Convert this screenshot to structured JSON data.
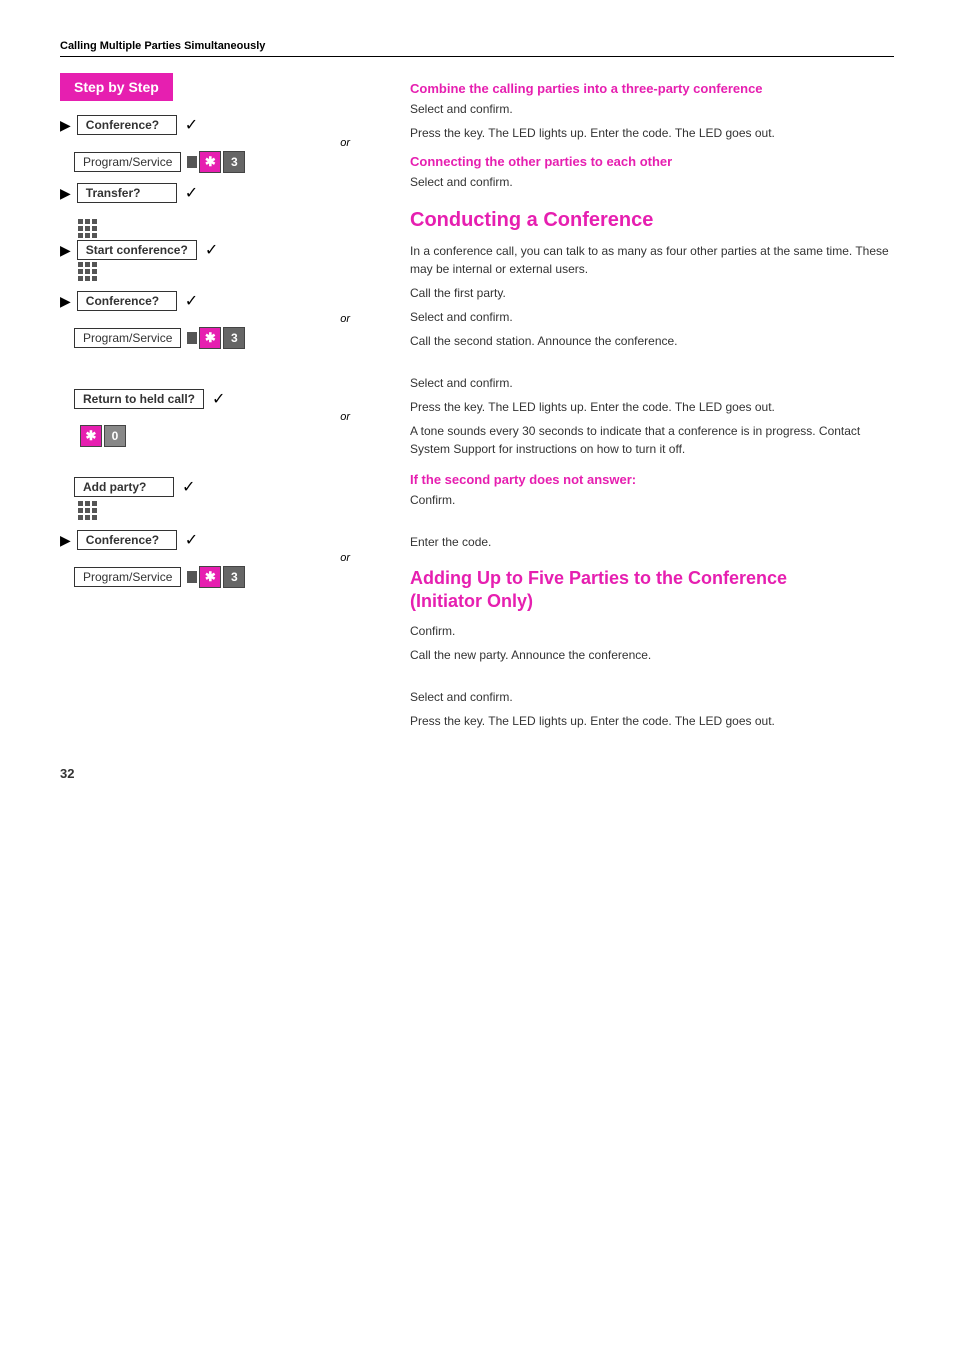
{
  "page": {
    "section_header": "Calling Multiple Parties Simultaneously",
    "step_by_step_label": "Step by Step",
    "page_number": "32"
  },
  "left": {
    "groups": [
      {
        "id": "group1",
        "rows": [
          {
            "type": "arrow-btn-check",
            "arrow": true,
            "label": "Conference?",
            "check": true
          },
          {
            "type": "or",
            "text": "or"
          },
          {
            "type": "prog-key",
            "prog_label": "Program/Service",
            "key_star": "*",
            "key_num": "3"
          }
        ]
      },
      {
        "id": "group2",
        "rows": [
          {
            "type": "arrow-btn-check",
            "arrow": true,
            "label": "Transfer?",
            "check": true
          }
        ]
      },
      {
        "id": "group3",
        "rows": [
          {
            "type": "dots-only"
          },
          {
            "type": "arrow-btn-check",
            "arrow": true,
            "label": "Start conference?",
            "check": true
          },
          {
            "type": "dots-only"
          }
        ]
      },
      {
        "id": "group4",
        "rows": [
          {
            "type": "arrow-btn-check",
            "arrow": true,
            "label": "Conference?",
            "check": true
          },
          {
            "type": "or",
            "text": "or"
          },
          {
            "type": "prog-key",
            "prog_label": "Program/Service",
            "key_star": "*",
            "key_num": "3"
          }
        ]
      },
      {
        "id": "group5",
        "rows": [
          {
            "type": "btn-check-noarrow",
            "label": "Return to held call?",
            "check": true
          },
          {
            "type": "or",
            "text": "or"
          },
          {
            "type": "star-zero",
            "key_star": "*",
            "key_num": "0"
          }
        ]
      },
      {
        "id": "group6",
        "rows": [
          {
            "type": "btn-check-noarrow",
            "label": "Add party?",
            "check": true
          },
          {
            "type": "dots-only"
          }
        ]
      },
      {
        "id": "group7",
        "rows": [
          {
            "type": "arrow-btn-check",
            "arrow": true,
            "label": "Conference?",
            "check": true
          },
          {
            "type": "or",
            "text": "or"
          },
          {
            "type": "prog-key",
            "prog_label": "Program/Service",
            "key_star": "*",
            "key_num": "3"
          }
        ]
      }
    ]
  },
  "right": {
    "sections": [
      {
        "id": "combine",
        "type": "pink-heading",
        "heading": "Combine the calling parties into a three-party conference",
        "items": [
          {
            "type": "body",
            "text": "Select and confirm."
          },
          {
            "type": "body",
            "text": "Press the key. The LED lights up. Enter the code. The LED goes out."
          }
        ]
      },
      {
        "id": "connecting",
        "type": "pink-heading",
        "heading": "Connecting the other parties to each other",
        "items": [
          {
            "type": "body",
            "text": "Select and confirm."
          }
        ]
      },
      {
        "id": "conducting",
        "type": "large-title",
        "title": "Conducting a Conference",
        "intro": "In a conference call, you can talk to as many as four other parties at the same time. These may be internal or external users.",
        "items": [
          {
            "type": "body",
            "text": "Call the first party."
          },
          {
            "type": "body",
            "text": "Select and confirm."
          },
          {
            "type": "body",
            "text": "Call the second station. Announce the conference."
          },
          {
            "type": "spacer"
          },
          {
            "type": "body",
            "text": "Select and confirm."
          },
          {
            "type": "body",
            "text": "Press the key. The LED lights up. Enter the code. The LED goes out."
          },
          {
            "type": "body",
            "text": "A tone sounds every 30 seconds to indicate that a conference is in progress. Contact System Support for instructions on how to turn it off."
          }
        ]
      },
      {
        "id": "second-party",
        "type": "pink-heading",
        "heading": "If the second party does not answer:",
        "items": [
          {
            "type": "body",
            "text": "Confirm."
          },
          {
            "type": "spacer"
          },
          {
            "type": "body",
            "text": "Enter the code."
          }
        ]
      },
      {
        "id": "adding",
        "type": "medium-title",
        "title": "Adding Up to Five Parties to the Conference",
        "title2": "(Initiator Only)",
        "items": [
          {
            "type": "body",
            "text": "Confirm."
          },
          {
            "type": "body",
            "text": "Call the new party. Announce the conference."
          },
          {
            "type": "spacer"
          },
          {
            "type": "body",
            "text": "Select and confirm."
          },
          {
            "type": "body",
            "text": "Press the key. The LED lights up. Enter the code. The LED goes out."
          }
        ]
      }
    ]
  }
}
